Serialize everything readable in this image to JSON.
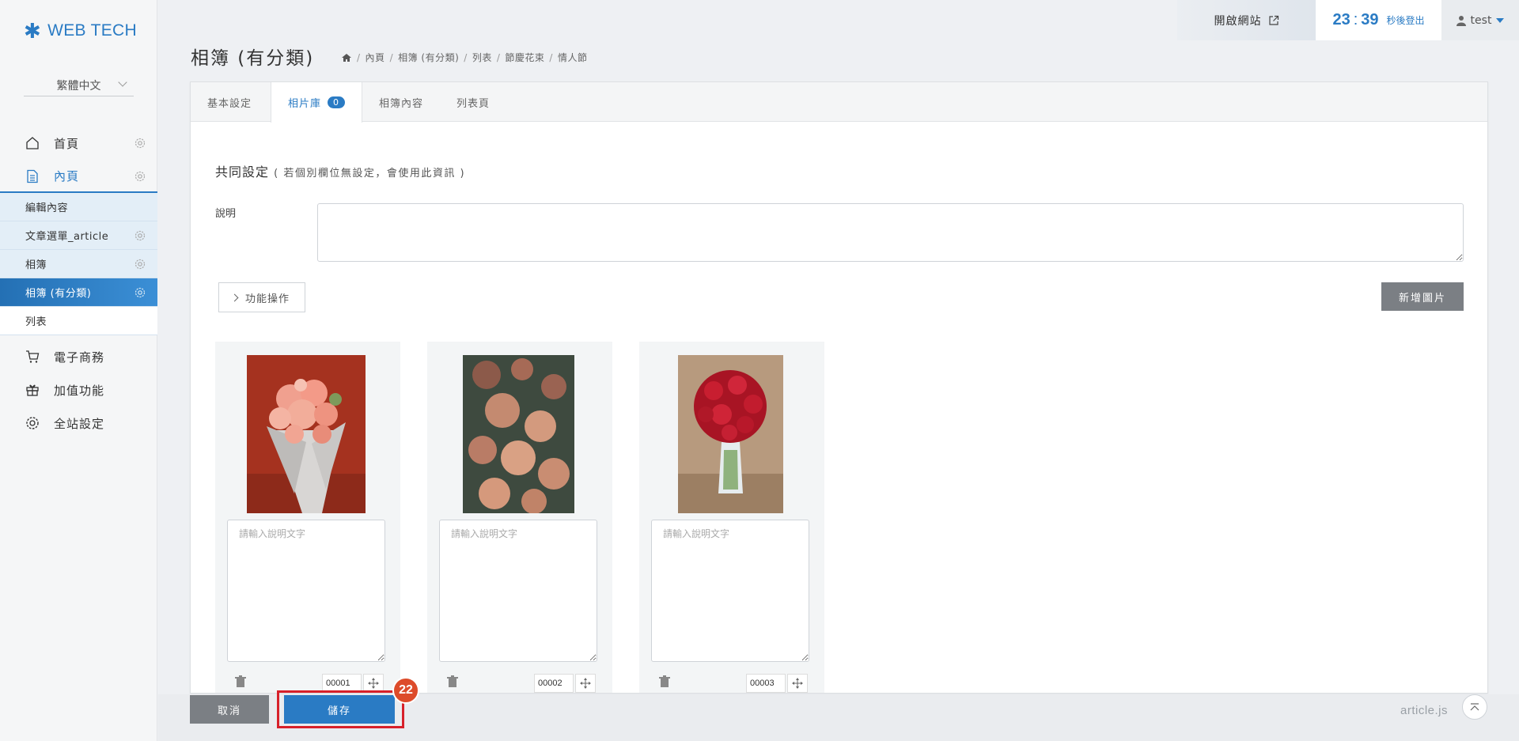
{
  "brand": {
    "name": "WEB TECH"
  },
  "language": {
    "selected": "繁體中文"
  },
  "sidebar": {
    "items": [
      {
        "label": "首頁"
      },
      {
        "label": "內頁"
      }
    ],
    "sub_items": [
      {
        "label": "編輯內容"
      },
      {
        "label": "文章選單_article"
      },
      {
        "label": "相簿"
      },
      {
        "label": "相簿 (有分類)"
      },
      {
        "label": "列表"
      }
    ],
    "items2": [
      {
        "label": "電子商務"
      },
      {
        "label": "加值功能"
      },
      {
        "label": "全站設定"
      }
    ]
  },
  "topbar": {
    "open_site": "開啟網站",
    "timer_min": "23",
    "timer_colon": ":",
    "timer_sec": "39",
    "timer_suffix": "秒後登出",
    "user": "test"
  },
  "page": {
    "title": "相簿 (有分類)",
    "breadcrumb": [
      "內頁",
      "相簿 (有分類)",
      "列表",
      "節慶花束",
      "情人節"
    ],
    "breadcrumb_sep": "/"
  },
  "tabs": [
    {
      "label": "基本設定"
    },
    {
      "label": "相片庫",
      "badge": "0"
    },
    {
      "label": "相簿內容"
    },
    {
      "label": "列表頁"
    }
  ],
  "common": {
    "title": "共同設定",
    "note": "( 若個別欄位無設定，會使用此資訊 )",
    "desc_label": "說明"
  },
  "actions": {
    "func": "功能操作",
    "add_photo": "新增圖片"
  },
  "photos": [
    {
      "placeholder": "請輸入說明文字",
      "order": "00001"
    },
    {
      "placeholder": "請輸入說明文字",
      "order": "00002"
    },
    {
      "placeholder": "請輸入說明文字",
      "order": "00003"
    }
  ],
  "bottom": {
    "cancel": "取消",
    "save": "儲存",
    "step": "22",
    "file": "article.js"
  },
  "colors": {
    "accent": "#2a7bc4",
    "gray_button": "#7b7f84",
    "highlight": "#d7202a",
    "step_badge": "#dd4b2a"
  }
}
